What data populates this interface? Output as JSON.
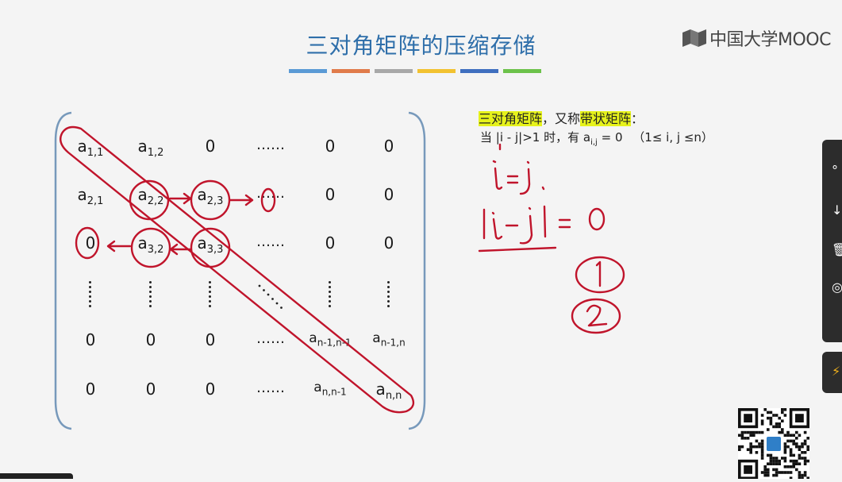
{
  "slide": {
    "title": "三对角矩阵的压缩存储",
    "color_bars": [
      "#5a9ad5",
      "#e07b4a",
      "#a8a8a8",
      "#f2c230",
      "#3f6fbf",
      "#6cc24a"
    ]
  },
  "logo": {
    "text": "中国大学MOOC"
  },
  "matrix": {
    "rows": [
      [
        {
          "b": "a",
          "s": "1,1"
        },
        {
          "b": "a",
          "s": "1,2"
        },
        {
          "b": "0",
          "s": ""
        },
        {
          "b": "……",
          "s": ""
        },
        {
          "b": "0",
          "s": ""
        },
        {
          "b": "0",
          "s": ""
        }
      ],
      [
        {
          "b": "a",
          "s": "2,1"
        },
        {
          "b": "a",
          "s": "2,2"
        },
        {
          "b": "a",
          "s": "2,3"
        },
        {
          "b": "……",
          "s": ""
        },
        {
          "b": "0",
          "s": ""
        },
        {
          "b": "0",
          "s": ""
        }
      ],
      [
        {
          "b": "0",
          "s": ""
        },
        {
          "b": "a",
          "s": "3,2"
        },
        {
          "b": "a",
          "s": "3,3"
        },
        {
          "b": "……",
          "s": ""
        },
        {
          "b": "0",
          "s": ""
        },
        {
          "b": "0",
          "s": ""
        }
      ],
      [
        {
          "b": "⋮",
          "s": ""
        },
        {
          "b": "⋮",
          "s": ""
        },
        {
          "b": "⋮",
          "s": ""
        },
        {
          "b": "⋱",
          "s": ""
        },
        {
          "b": "⋮",
          "s": ""
        },
        {
          "b": "⋮",
          "s": ""
        }
      ],
      [
        {
          "b": "0",
          "s": ""
        },
        {
          "b": "0",
          "s": ""
        },
        {
          "b": "0",
          "s": ""
        },
        {
          "b": "……",
          "s": ""
        },
        {
          "b": "a",
          "s": "n-1,n-1"
        },
        {
          "b": "a",
          "s": "n-1,n"
        }
      ],
      [
        {
          "b": "0",
          "s": ""
        },
        {
          "b": "0",
          "s": ""
        },
        {
          "b": "0",
          "s": ""
        },
        {
          "b": "……",
          "s": ""
        },
        {
          "b": "a",
          "s": "n,n-1"
        },
        {
          "b": "a",
          "s": "n,n"
        }
      ]
    ]
  },
  "definition": {
    "term": "三对角矩阵",
    "connector": "，又称",
    "alt_term": "带状矩阵",
    "colon": "：",
    "line2_prefix": "当",
    "cond": "|i - j|>1",
    "line2_mid": "时，有",
    "a_base": "a",
    "a_sub": "i,j",
    "line2_eq": "= 0",
    "range": "（1≤ i, j ≤n）"
  },
  "handwriting": {
    "eq1": "i=j.",
    "eq2": "|i-j|=0",
    "n1": "1",
    "n2": "2"
  },
  "annotation_color": "#c0142b"
}
